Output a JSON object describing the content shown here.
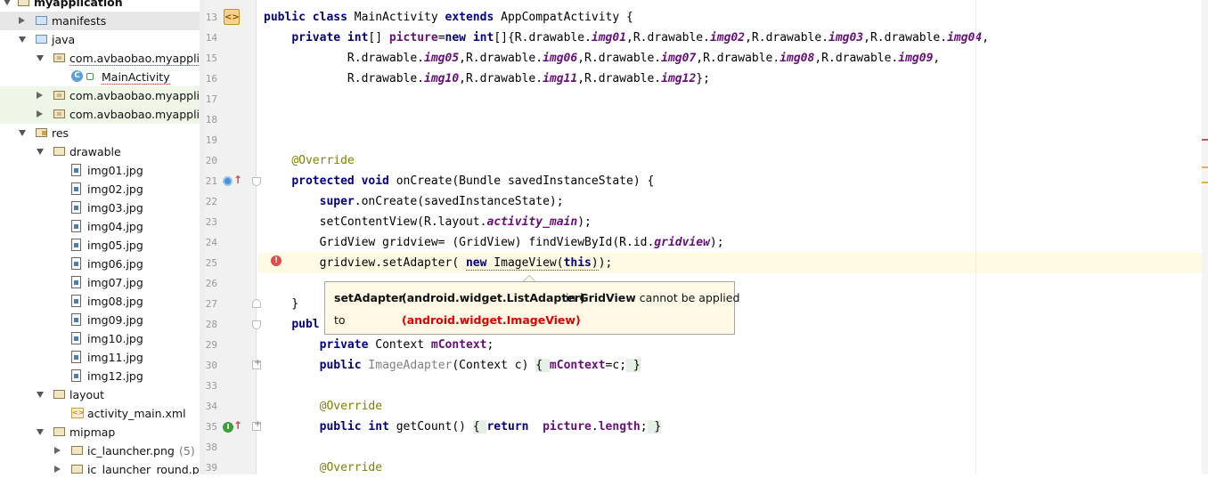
{
  "project_tree": {
    "root": "myapplication",
    "items": [
      {
        "label": "manifests",
        "indent": 1,
        "arrow": "right",
        "icon": "folder-blue",
        "highlight": true
      },
      {
        "label": "java",
        "indent": 1,
        "arrow": "down",
        "icon": "folder-blue"
      },
      {
        "label": "com.avbaobao.myapplica",
        "indent": 2,
        "arrow": "down",
        "icon": "package",
        "squiggle": true
      },
      {
        "label": "MainActivity",
        "indent": 3,
        "icon": "class",
        "squiggle": true
      },
      {
        "label": "com.avbaobao.myapplica",
        "indent": 2,
        "arrow": "right",
        "icon": "package",
        "green": true
      },
      {
        "label": "com.avbaobao.myapplica",
        "indent": 2,
        "arrow": "right",
        "icon": "package",
        "green": true
      },
      {
        "label": "res",
        "indent": 1,
        "arrow": "down",
        "icon": "folder-res"
      },
      {
        "label": "drawable",
        "indent": 2,
        "arrow": "down",
        "icon": "folder"
      },
      {
        "label": "img01.jpg",
        "indent": 3,
        "icon": "image"
      },
      {
        "label": "img02.jpg",
        "indent": 3,
        "icon": "image"
      },
      {
        "label": "img03.jpg",
        "indent": 3,
        "icon": "image"
      },
      {
        "label": "img04.jpg",
        "indent": 3,
        "icon": "image"
      },
      {
        "label": "img05.jpg",
        "indent": 3,
        "icon": "image"
      },
      {
        "label": "img06.jpg",
        "indent": 3,
        "icon": "image"
      },
      {
        "label": "img07.jpg",
        "indent": 3,
        "icon": "image"
      },
      {
        "label": "img08.jpg",
        "indent": 3,
        "icon": "image"
      },
      {
        "label": "img09.jpg",
        "indent": 3,
        "icon": "image"
      },
      {
        "label": "img10.jpg",
        "indent": 3,
        "icon": "image"
      },
      {
        "label": "img11.jpg",
        "indent": 3,
        "icon": "image"
      },
      {
        "label": "img12.jpg",
        "indent": 3,
        "icon": "image"
      },
      {
        "label": "layout",
        "indent": 2,
        "arrow": "down",
        "icon": "folder"
      },
      {
        "label": "activity_main.xml",
        "indent": 3,
        "icon": "xml"
      },
      {
        "label": "mipmap",
        "indent": 2,
        "arrow": "down",
        "icon": "folder"
      },
      {
        "label": "ic_launcher.png",
        "count": "(5)",
        "indent": 3,
        "arrow": "right",
        "icon": "folder"
      },
      {
        "label": "ic_launcher_round.png",
        "indent": 3,
        "arrow": "right",
        "icon": "folder"
      }
    ]
  },
  "editor": {
    "lines": [
      {
        "num": "13",
        "html": "<span class=\"kw\">public class </span>MainActivity <span class=\"kw\">extends </span>AppCompatActivity {"
      },
      {
        "num": "14",
        "html": "    <span class=\"kw\">private int</span>[] <span class=\"fldb\">picture</span>=<span class=\"kw\">new int</span>[]{R.drawable.<span class=\"fld\">img01</span>,R.drawable.<span class=\"fld\">img02</span>,R.drawable.<span class=\"fld\">img03</span>,R.drawable.<span class=\"fld\">img04</span>,"
      },
      {
        "num": "15",
        "html": "            R.drawable.<span class=\"fld\">img05</span>,R.drawable.<span class=\"fld\">img06</span>,R.drawable.<span class=\"fld\">img07</span>,R.drawable.<span class=\"fld\">img08</span>,R.drawable.<span class=\"fld\">img09</span>,"
      },
      {
        "num": "16",
        "html": "            R.drawable.<span class=\"fld\">img10</span>,R.drawable.<span class=\"fld\">img11</span>,R.drawable.<span class=\"fld\">img12</span>};"
      },
      {
        "num": "17",
        "html": ""
      },
      {
        "num": "18",
        "html": ""
      },
      {
        "num": "19",
        "html": ""
      },
      {
        "num": "20",
        "html": "    <span class=\"ann\">@Override</span>"
      },
      {
        "num": "21",
        "html": "    <span class=\"kw\">protected void </span>onCreate(Bundle savedInstanceState) {"
      },
      {
        "num": "22",
        "html": "        <span class=\"kw\">super</span>.onCreate(savedInstanceState);"
      },
      {
        "num": "23",
        "html": "        setContentView(R.layout.<span class=\"fld\">activity_main</span>);"
      },
      {
        "num": "24",
        "html": "        GridView gridview= (GridView) findViewById(R.id.<span class=\"fld\">gridview</span>);"
      },
      {
        "num": "25",
        "html": "        gridview.setAdapter( <span class=\"err-ul\"><span class=\"kw\">new </span>ImageView(<span class=\"kw\">this</span>)</span>);",
        "current": true
      },
      {
        "num": "26",
        "html": ""
      },
      {
        "num": "27",
        "html": "    }"
      },
      {
        "num": "28",
        "html": "    <span class=\"kw\">publ</span>"
      },
      {
        "num": "29",
        "html": "        <span class=\"kw\">private </span>Context <span class=\"fldb\">mContext</span>;"
      },
      {
        "num": "30",
        "html": "        <span class=\"kw\">public </span><span class=\"grey\">ImageAdapter</span>(Context c) <span class=\"fold-hl\">{ </span><span class=\"fldb\">mContext</span>=c;<span class=\"fold-hl\"> }</span>"
      },
      {
        "num": "33",
        "html": ""
      },
      {
        "num": "34",
        "html": "        <span class=\"ann\">@Override</span>"
      },
      {
        "num": "35",
        "html": "        <span class=\"kw\">public int </span>getCount() <span class=\"fold-hl\">{ </span><span class=\"kw\">return  </span><span class=\"fldb\">picture</span>.<span class=\"fldb\">length</span>;<span class=\"fold-hl\"> }</span>"
      },
      {
        "num": "38",
        "html": ""
      },
      {
        "num": "39",
        "html": "        <span class=\"ann\">@Override</span>"
      }
    ]
  },
  "tooltip": {
    "method": "setAdapter",
    "param_type": "(android.widget.ListAdapter)",
    "in_text": "in",
    "class_name": "GridView",
    "message": "cannot be applied",
    "to_text": "to",
    "arg_type": "(android.widget.ImageView)"
  },
  "colors": {
    "keyword": "#000080",
    "field": "#660e7a",
    "annotation": "#808000",
    "error": "#e00000",
    "current_line": "#fffae3",
    "tooltip_bg": "#fff9e6"
  }
}
